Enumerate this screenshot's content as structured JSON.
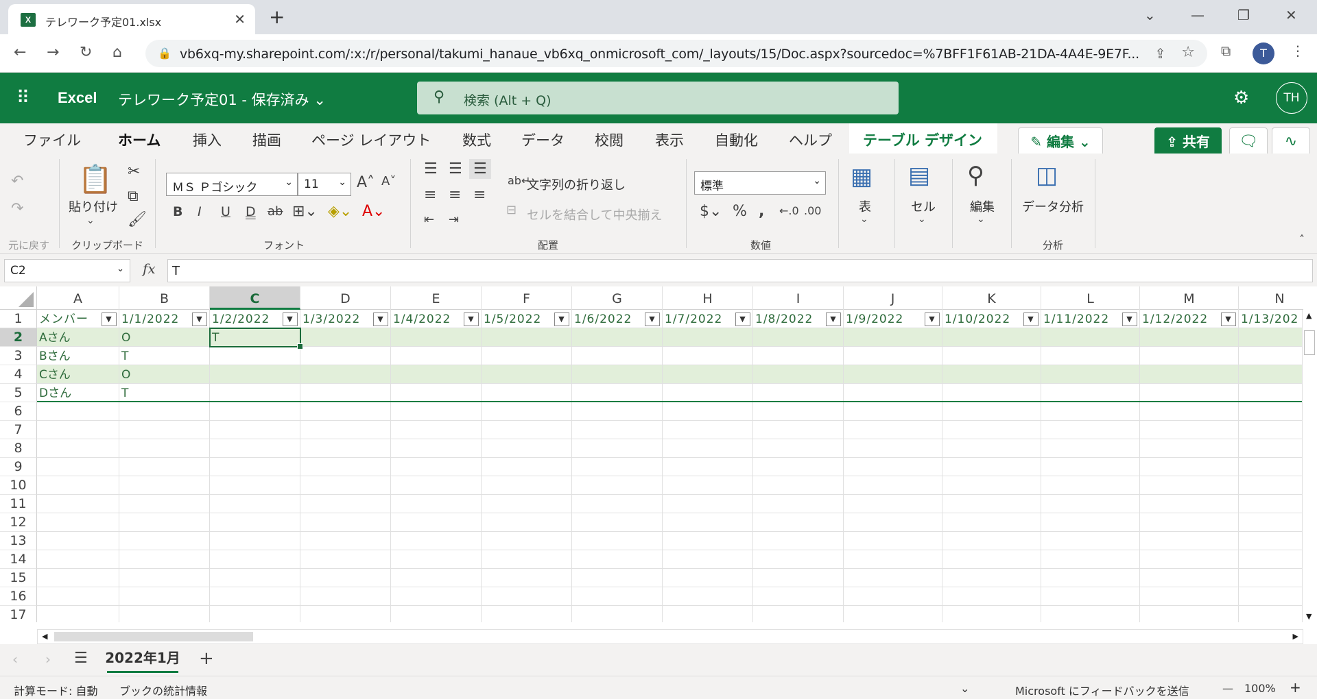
{
  "browser": {
    "tab_title": "テレワーク予定01.xlsx",
    "tab_icon": "X",
    "close": "✕",
    "new_tab": "+",
    "url": "vb6xq-my.sharepoint.com/:x:/r/personal/takumi_hanaue_vb6xq_onmicrosoft_com/_layouts/15/Doc.aspx?sourcedoc=%7BFF1F61AB-21DA-4A4E-9E7F...",
    "profile": "T"
  },
  "app": {
    "name": "Excel",
    "doc_title": "テレワーク予定01 - 保存済み ⌄",
    "search_placeholder": "検索 (Alt + Q)",
    "avatar": "TH"
  },
  "menu": {
    "items": [
      "ファイル",
      "ホーム",
      "挿入",
      "描画",
      "ページ レイアウト",
      "数式",
      "データ",
      "校閲",
      "表示",
      "自動化",
      "ヘルプ"
    ],
    "design": "テーブル デザイン",
    "edit": "✎ 編集 ⌄",
    "share": "⇪ 共有"
  },
  "ribbon": {
    "undo_label": "元に戻す",
    "paste": "貼り付け",
    "clipboard": "クリップボード",
    "font_name": "ＭＳ Ｐゴシック",
    "font_size": "11",
    "font_group": "フォント",
    "wrap": "文字列の折り返し",
    "merge": "セルを結合して中央揃え",
    "align_group": "配置",
    "number_format": "標準",
    "number_group": "数値",
    "table": "表",
    "cells": "セル",
    "editing": "編集",
    "analyze": "データ分析",
    "analysis_group": "分析"
  },
  "formula_bar": {
    "name_box": "C2",
    "fx": "fx",
    "content": "T"
  },
  "columns": [
    "A",
    "B",
    "C",
    "D",
    "E",
    "F",
    "G",
    "H",
    "I",
    "J",
    "K",
    "L",
    "M",
    "N"
  ],
  "header_row": [
    "メンバー",
    "1/1/2022",
    "1/2/2022",
    "1/3/2022",
    "1/4/2022",
    "1/5/2022",
    "1/6/2022",
    "1/7/2022",
    "1/8/2022",
    "1/9/2022",
    "1/10/2022",
    "1/11/2022",
    "1/12/2022",
    "1/13/202"
  ],
  "rows": [
    [
      "Aさん",
      "O",
      "T"
    ],
    [
      "Bさん",
      "T",
      ""
    ],
    [
      "Cさん",
      "O",
      ""
    ],
    [
      "Dさん",
      "T",
      ""
    ]
  ],
  "row_numbers": [
    "1",
    "2",
    "3",
    "4",
    "5",
    "6",
    "7",
    "8",
    "9",
    "10",
    "11",
    "12",
    "13",
    "14",
    "15",
    "16",
    "17"
  ],
  "sheet": {
    "name": "2022年1月",
    "add": "+"
  },
  "status": {
    "calc_mode": "計算モード: 自動",
    "workbook_stats": "ブックの統計情報",
    "feedback": "Microsoft にフィードバックを送信",
    "zoom": "100%"
  }
}
